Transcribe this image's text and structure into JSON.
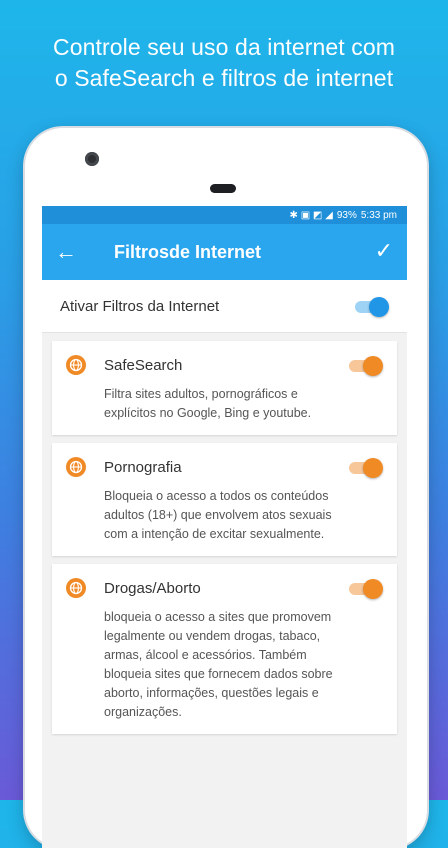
{
  "headline": {
    "line1": "Controle seu uso da internet com",
    "line2": "o SafeSearch e filtros de internet"
  },
  "statusbar": {
    "icons": "✱ ▣ ◩ ◢",
    "battery": "93%",
    "time": "5:33 pm"
  },
  "appbar": {
    "back_icon": "←",
    "title": "Filtrosde Internet",
    "confirm_icon": "✓"
  },
  "master": {
    "label": "Ativar Filtros da Internet",
    "enabled": true,
    "toggle_color": "#2196e6"
  },
  "filters": [
    {
      "title": "SafeSearch",
      "description": "Filtra sites adultos, pornográficos e explícitos no Google, Bing e youtube.",
      "enabled": true
    },
    {
      "title": "Pornografia",
      "description": "Bloqueia o acesso a todos os conteúdos adultos (18+) que envolvem atos sexuais com a intenção de excitar sexualmente.",
      "enabled": true
    },
    {
      "title": "Drogas/Aborto",
      "description": "bloqueia o acesso a sites que promovem legalmente ou vendem drogas, tabaco, armas, álcool e acessórios. Também bloqueia sites que fornecem dados sobre aborto, informações, questões legais e organizações.",
      "enabled": true
    }
  ],
  "colors": {
    "accent": "#2aa6ef",
    "filter_toggle": "#ef8a25"
  }
}
